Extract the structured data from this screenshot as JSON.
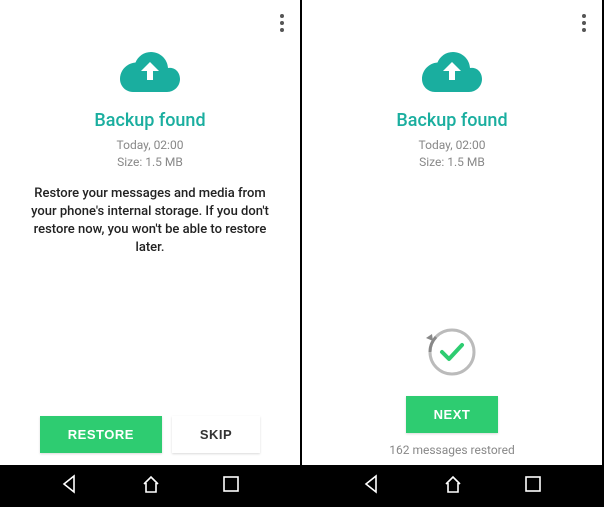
{
  "left": {
    "title": "Backup found",
    "time": "Today, 02:00",
    "size": "Size: 1.5 MB",
    "desc": "Restore your messages and media from your phone's internal storage. If you don't restore now, you won't be able to restore later.",
    "restore_label": "RESTORE",
    "skip_label": "SKIP"
  },
  "right": {
    "title": "Backup found",
    "time": "Today, 02:00",
    "size": "Size: 1.5 MB",
    "next_label": "NEXT",
    "status": "162 messages restored"
  },
  "colors": {
    "accent": "#1aae9f",
    "button_green": "#2ecc71"
  }
}
